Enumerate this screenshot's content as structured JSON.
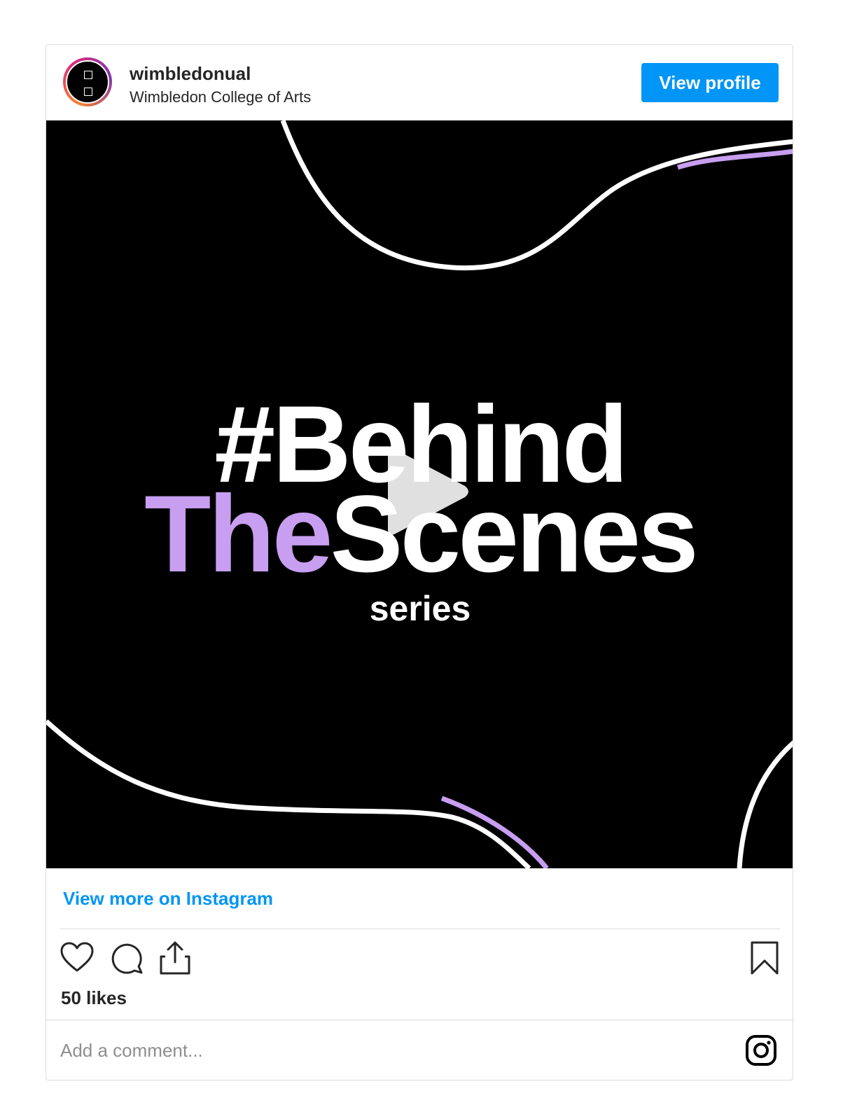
{
  "post": {
    "username": "wimbledonual",
    "full_name": "Wimbledon College of Arts",
    "view_profile_label": "View profile",
    "media": {
      "line1": "#Behind",
      "line2_accent": "The",
      "line2_rest": "Scenes",
      "line3": "series",
      "accent_color": "#c79ef0"
    },
    "view_more_label": "View more on Instagram",
    "likes_text": "50 likes",
    "comment_placeholder": "Add a comment...",
    "icons": [
      "heart-icon",
      "comment-icon",
      "share-icon",
      "bookmark-icon",
      "instagram-icon",
      "play-icon"
    ],
    "brand_color": "#0095f6"
  }
}
